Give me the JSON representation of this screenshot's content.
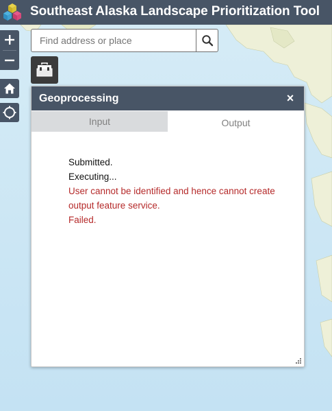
{
  "app": {
    "title": "Southeast Alaska Landscape Prioritization Tool"
  },
  "search": {
    "placeholder": "Find address or place"
  },
  "colors": {
    "header": "#485566",
    "water": "#cfe6f2",
    "land": "#eef0d8",
    "error_text": "#b52a2a"
  },
  "icons": {
    "logo": "hexagon-cubes-icon",
    "zoom_in": "plus-icon",
    "zoom_out": "minus-icon",
    "home": "home-icon",
    "locate": "locate-icon",
    "search": "search-icon",
    "toolbox": "toolbox-icon",
    "close": "close-icon"
  },
  "panel": {
    "title": "Geoprocessing",
    "close_label": "×",
    "tabs": [
      {
        "label": "Input",
        "selected": false
      },
      {
        "label": "Output",
        "selected": true
      }
    ],
    "messages": [
      {
        "text": "Submitted.",
        "type": "info"
      },
      {
        "text": "Executing...",
        "type": "info"
      },
      {
        "text": "User cannot be identified and hence cannot create output feature service.",
        "type": "error"
      },
      {
        "text": "Failed.",
        "type": "error"
      }
    ]
  }
}
